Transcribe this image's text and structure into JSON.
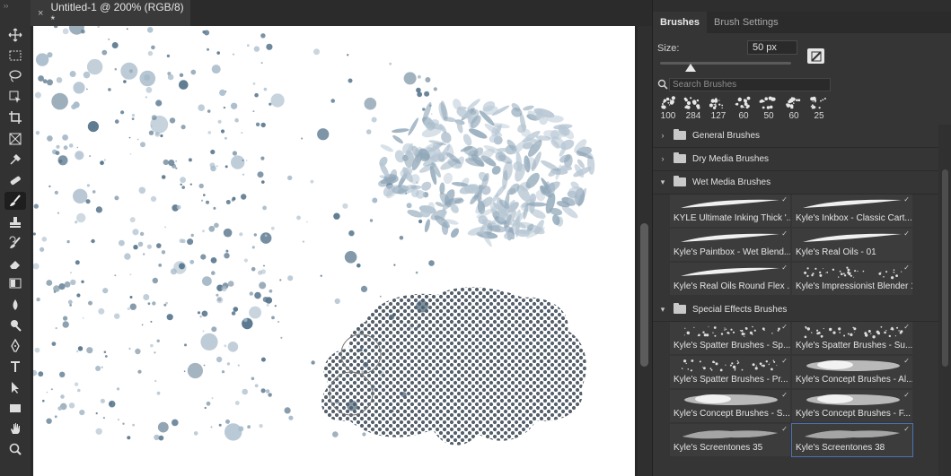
{
  "document": {
    "tab_title": "Untitled-1 @ 200% (RGB/8) *",
    "close_glyph": "×"
  },
  "toolbar": {
    "tools": [
      {
        "name": "move-tool",
        "icon": "move-icon"
      },
      {
        "name": "marquee-tool",
        "icon": "marquee-icon"
      },
      {
        "name": "lasso-tool",
        "icon": "lasso-icon"
      },
      {
        "name": "object-select-tool",
        "icon": "object-select-icon"
      },
      {
        "name": "crop-tool",
        "icon": "crop-icon"
      },
      {
        "name": "frame-tool",
        "icon": "frame-icon"
      },
      {
        "name": "eyedropper-tool",
        "icon": "eyedropper-icon"
      },
      {
        "name": "healing-tool",
        "icon": "bandage-icon"
      },
      {
        "name": "brush-tool",
        "icon": "brush-icon",
        "active": true
      },
      {
        "name": "stamp-tool",
        "icon": "stamp-icon"
      },
      {
        "name": "history-brush-tool",
        "icon": "history-brush-icon"
      },
      {
        "name": "eraser-tool",
        "icon": "eraser-icon"
      },
      {
        "name": "gradient-tool",
        "icon": "gradient-icon"
      },
      {
        "name": "blur-tool",
        "icon": "blur-drop-icon"
      },
      {
        "name": "dodge-tool",
        "icon": "dodge-icon"
      },
      {
        "name": "pen-tool",
        "icon": "pen-icon"
      },
      {
        "name": "type-tool",
        "icon": "type-icon"
      },
      {
        "name": "path-select-tool",
        "icon": "arrow-icon"
      },
      {
        "name": "rectangle-tool",
        "icon": "rectangle-icon"
      },
      {
        "name": "hand-tool",
        "icon": "hand-icon"
      },
      {
        "name": "zoom-tool",
        "icon": "zoom-icon"
      }
    ]
  },
  "panel": {
    "tabs": [
      "Brushes",
      "Brush Settings"
    ],
    "active_tab": "Brushes",
    "size_label": "Size:",
    "size_value": "50 px",
    "slider_fraction": 0.23,
    "search_placeholder": "Search Brushes",
    "recent_brushes": [
      "100",
      "284",
      "127",
      "60",
      "50",
      "60",
      "25"
    ],
    "groups": [
      {
        "label": "General Brushes",
        "expanded": false
      },
      {
        "label": "Dry Media Brushes",
        "expanded": false
      },
      {
        "label": "Wet Media Brushes",
        "expanded": true,
        "brushes": [
          "KYLE Ultimate Inking Thick '...",
          "Kyle's Inkbox - Classic Cart...",
          "Kyle's Paintbox - Wet Blend...",
          "Kyle's Real Oils - 01",
          "Kyle's Real Oils Round Flex ...",
          "Kyle's Impressionist Blender 1"
        ]
      },
      {
        "label": "Special Effects Brushes",
        "expanded": true,
        "brushes": [
          "Kyle's Spatter Brushes - Sp...",
          "Kyle's Spatter Brushes - Su...",
          "Kyle's Spatter Brushes - Pr...",
          "Kyle's Concept Brushes - Al...",
          "Kyle's Concept Brushes - S...",
          "Kyle's Concept Brushes - F...",
          "Kyle's Screentones 35",
          "Kyle's Screentones 38"
        ]
      }
    ],
    "selected_brush": "Kyle's Screentones 38"
  },
  "colors": {
    "paint": "#5d7a90",
    "paint_light": "#a9bccb",
    "accent": "#4c73b3"
  }
}
